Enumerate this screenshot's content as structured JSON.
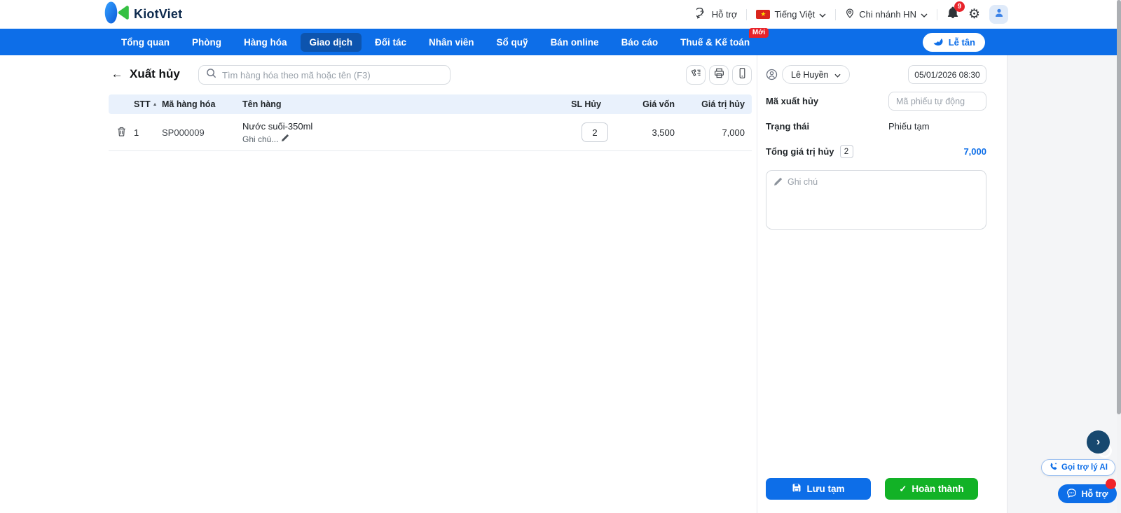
{
  "topbar": {
    "brand": "KiotViet",
    "support_label": "Hỗ trợ",
    "language_label": "Tiếng Việt",
    "branch_label": "Chi nhánh HN",
    "notification_count": "9"
  },
  "nav": {
    "items": [
      {
        "label": "Tổng quan"
      },
      {
        "label": "Phòng"
      },
      {
        "label": "Hàng hóa"
      },
      {
        "label": "Giao dịch"
      },
      {
        "label": "Đối tác"
      },
      {
        "label": "Nhân viên"
      },
      {
        "label": "Sổ quỹ"
      },
      {
        "label": "Bán online"
      },
      {
        "label": "Báo cáo"
      },
      {
        "label": "Thuế & Kế toán"
      }
    ],
    "badge_new": "Mới",
    "reception_label": "Lễ tân"
  },
  "main": {
    "title": "Xuất hủy",
    "search_placeholder": "Tìm hàng hóa theo mã hoặc tên (F3)",
    "table": {
      "headers": {
        "stt": "STT",
        "code": "Mã hàng hóa",
        "name": "Tên hàng",
        "qty": "SL Hủy",
        "cost": "Giá vốn",
        "value": "Giá trị hủy"
      },
      "rows": [
        {
          "stt": "1",
          "code": "SP000009",
          "name": "Nước suối-350ml",
          "note": "Ghi chú...",
          "qty": "2",
          "cost": "3,500",
          "value": "7,000"
        }
      ]
    }
  },
  "panel": {
    "user_name": "Lê Huyền",
    "datetime": "05/01/2026 08:30",
    "code_label": "Mã xuất hủy",
    "code_placeholder": "Mã phiếu tự động",
    "status_label": "Trạng thái",
    "status_value": "Phiếu tạm",
    "total_label": "Tổng giá trị hủy",
    "total_qty": "2",
    "total_value": "7,000",
    "note_placeholder": "Ghi chú",
    "save_draft_label": "Lưu tạm",
    "complete_label": "Hoàn thành"
  },
  "floating": {
    "ai_call_label": "Gọi trợ lý AI",
    "support_label": "Hỗ trợ"
  },
  "colors": {
    "nav_blue": "#0d6ee8",
    "active_tab_blue": "#0d54ae",
    "success_green": "#12b226",
    "alert_red": "#e8232a",
    "accent_blue": "#0d6ee8"
  }
}
